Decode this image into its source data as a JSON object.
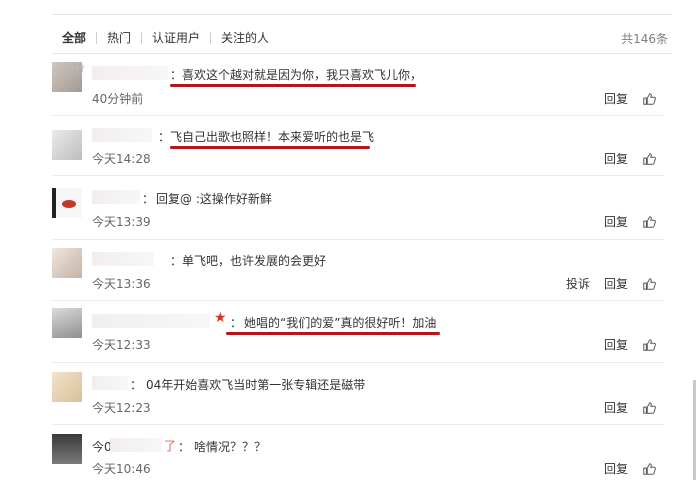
{
  "tabs": [
    "全部",
    "热门",
    "认证用户",
    "关注的人"
  ],
  "total": "共146条",
  "comments": [
    {
      "prefix": "：",
      "text": "喜欢这个越对就是因为你，我只喜欢飞儿你，",
      "time": "40分钟前",
      "extra": "40分",
      "actions": [
        "回复"
      ]
    },
    {
      "prefix": "：",
      "text": "飞自己出歌也照样！本来爱听的也是飞",
      "time": "今天14:28",
      "actions": [
        "回复"
      ]
    },
    {
      "prefix": "：",
      "text": "回复@          :这操作好新鲜",
      "time": "今天13:39",
      "actions": [
        "回复"
      ]
    },
    {
      "prefix": "：",
      "text": "单飞吧，也许发展的会更好",
      "time": "今天13:36",
      "actions": [
        "投诉",
        "回复"
      ]
    },
    {
      "prefix": "：",
      "text": "她唱的“我们的爱”真的很好听！加油",
      "time": "今天12:33",
      "actions": [
        "回复"
      ]
    },
    {
      "prefix": "：",
      "text": "04年开始喜欢飞当时第一张专辑还是磁带",
      "time": "今天12:23",
      "actions": [
        "回复"
      ]
    },
    {
      "prefix": "：",
      "text": "啥情况？？？",
      "time": "今天10:46",
      "extra": "今0",
      "nameTail": "了",
      "actions": [
        "回复"
      ]
    }
  ],
  "icons": {
    "like": "thumbs-up-icon",
    "star": "star-icon"
  },
  "colors": {
    "underline": "#b4141a",
    "star": "#e0301e"
  }
}
